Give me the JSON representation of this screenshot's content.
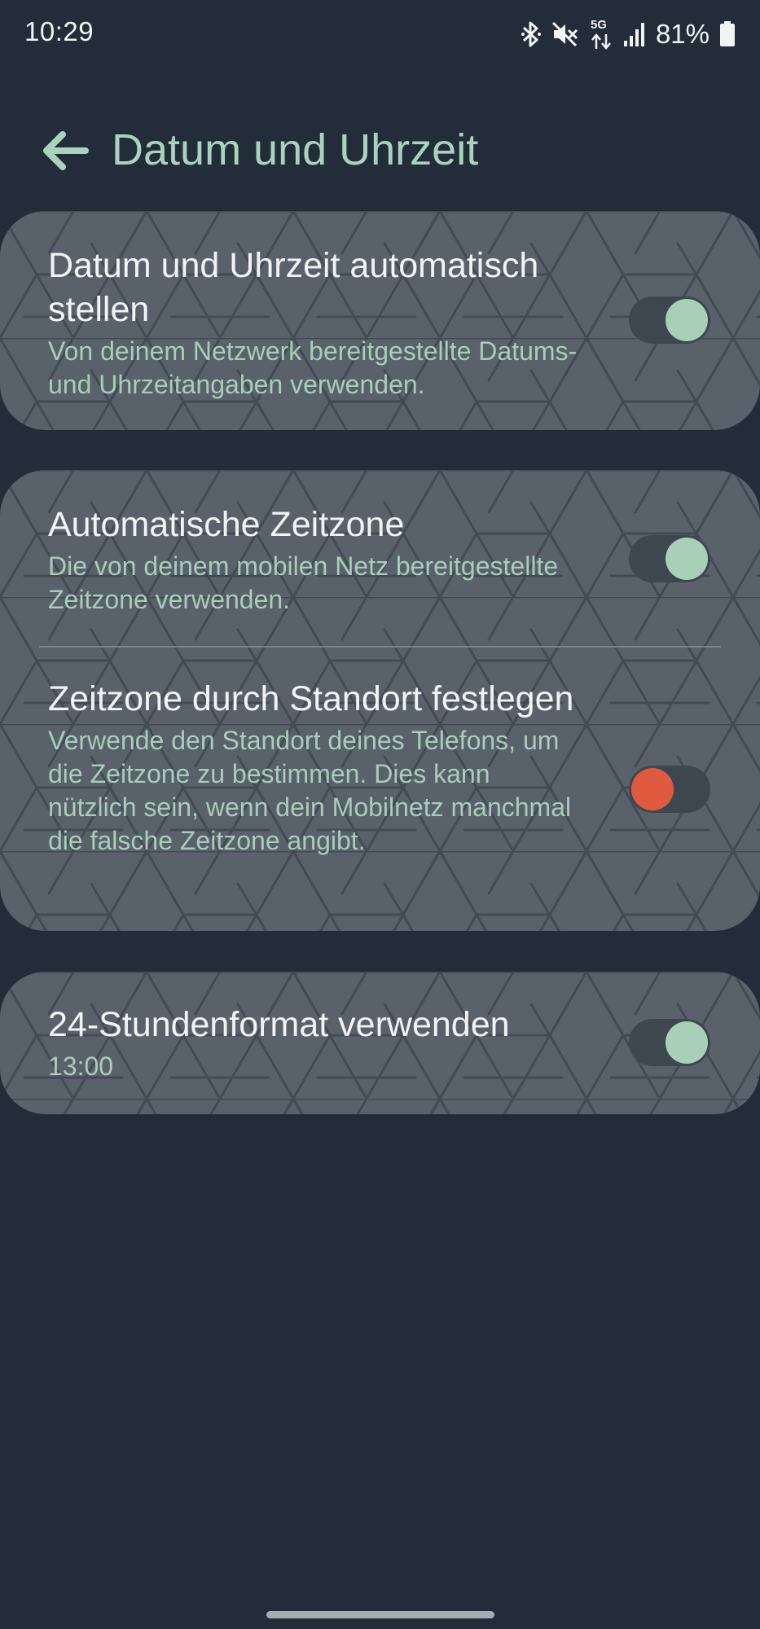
{
  "status_bar": {
    "time": "10:29",
    "battery_percent": "81%",
    "network_label": "5G",
    "icons": [
      "bluetooth-icon",
      "mute-icon",
      "network-5g-icon",
      "signal-icon",
      "battery-icon"
    ]
  },
  "header": {
    "title": "Datum und Uhrzeit",
    "back_icon": "arrow-back-icon"
  },
  "settings": {
    "auto_time": {
      "title": "Datum und Uhrzeit automatisch stellen",
      "summary": "Von deinem Netzwerk bereitgestellte Datums- und Uhrzeitangaben verwenden.",
      "enabled": true
    },
    "auto_timezone": {
      "title": "Automatische Zeitzone",
      "summary": "Die von deinem mobilen Netz bereitgestellte Zeitzone verwenden.",
      "enabled": true
    },
    "location_timezone": {
      "title": "Zeitzone durch Standort festlegen",
      "summary": "Verwende den Standort deines Telefons, um die Zeitzone zu bestimmen. Dies kann nützlich sein, wenn dein Mobilnetz manchmal die falsche Zeitzone angibt.",
      "enabled": false
    },
    "hour_24": {
      "title": "24-Stundenformat verwenden",
      "summary": "13:00",
      "enabled": true
    }
  },
  "colors": {
    "background": "#222d39",
    "card": "#59626a",
    "accent": "#a9d3bd",
    "toggle_off_thumb": "#e05a40"
  }
}
